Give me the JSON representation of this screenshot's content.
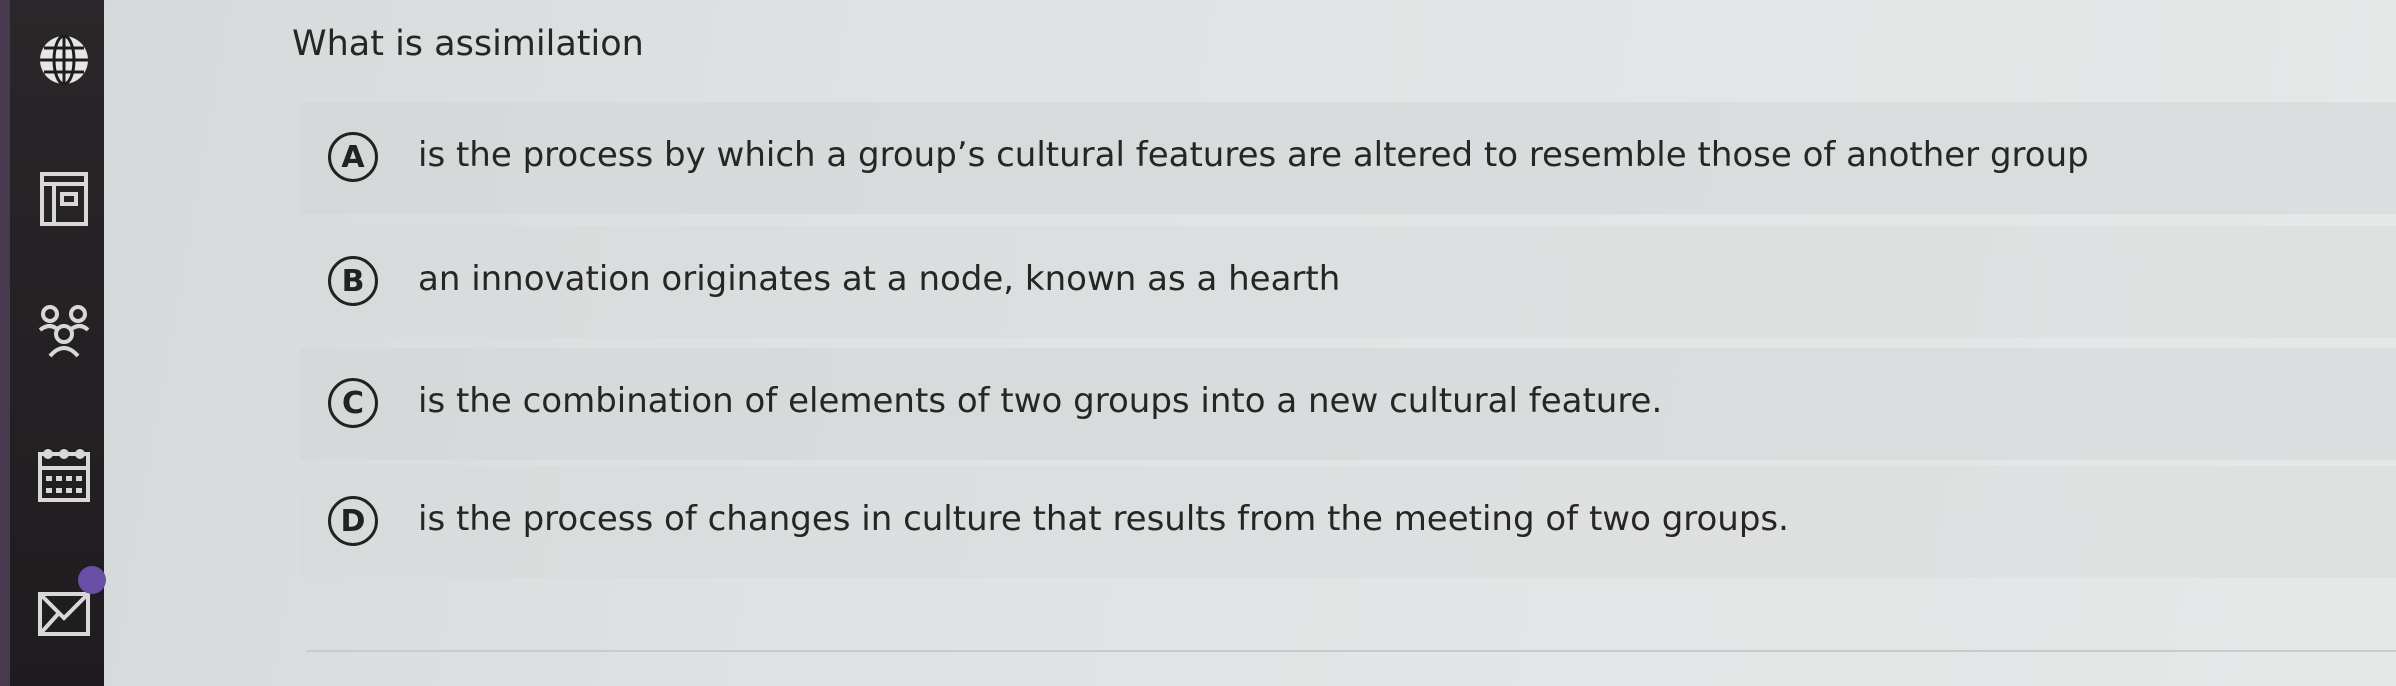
{
  "sidebar": {
    "icons": [
      "globe-icon",
      "browser-window-icon",
      "people-icon",
      "calendar-icon",
      "mail-icon"
    ]
  },
  "question": {
    "text": "What is assimilation"
  },
  "options": [
    {
      "letter": "A",
      "text": "is the process by which a group’s cultural features are altered to resemble those of another group"
    },
    {
      "letter": "B",
      "text": "an innovation originates at a node, known as a hearth"
    },
    {
      "letter": "C",
      "text": "is the combination of elements of two groups into a new cultural feature."
    },
    {
      "letter": "D",
      "text": "is the process of changes in culture that results from the meeting of two groups."
    }
  ]
}
